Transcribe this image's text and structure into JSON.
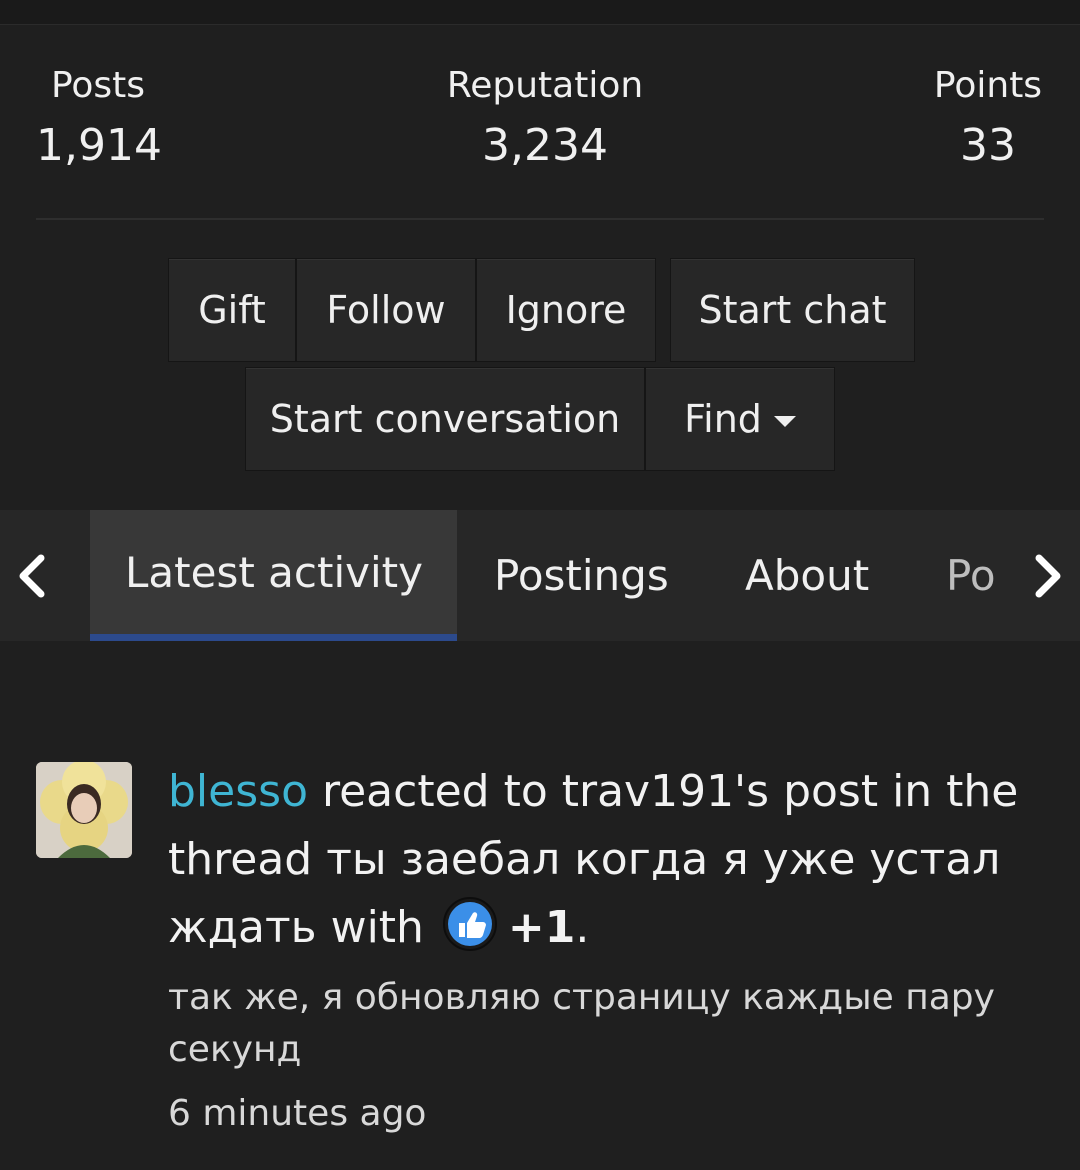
{
  "stats": {
    "posts_label": "Posts",
    "posts_value": "1,914",
    "reputation_label": "Reputation",
    "reputation_value": "3,234",
    "points_label": "Points",
    "points_value": "33"
  },
  "actions": {
    "gift": "Gift",
    "follow": "Follow",
    "ignore": "Ignore",
    "start_chat": "Start chat",
    "start_conversation": "Start conversation",
    "find": "Find"
  },
  "tabs": {
    "latest_activity": "Latest activity",
    "postings": "Postings",
    "about": "About",
    "partial": "Po"
  },
  "activity": {
    "user": "blesso",
    "reacted_text": " reacted to trav191's post in the thread ",
    "thread_title": "ты заебал когда я уже устал ждать",
    "with_text": " with ",
    "reaction": "+1",
    "period": ".",
    "snippet": "так же, я обновляю страницу каждые пару секунд",
    "time": "6 minutes ago"
  },
  "colors": {
    "background": "#1f1f1f",
    "username": "#3fb5d3",
    "active_tab_underline": "#2c4a8c"
  },
  "icons": {
    "prev": "chevron-left-icon",
    "next": "chevron-right-icon",
    "reaction": "thumbs-up-icon",
    "find_caret": "caret-down-icon"
  }
}
